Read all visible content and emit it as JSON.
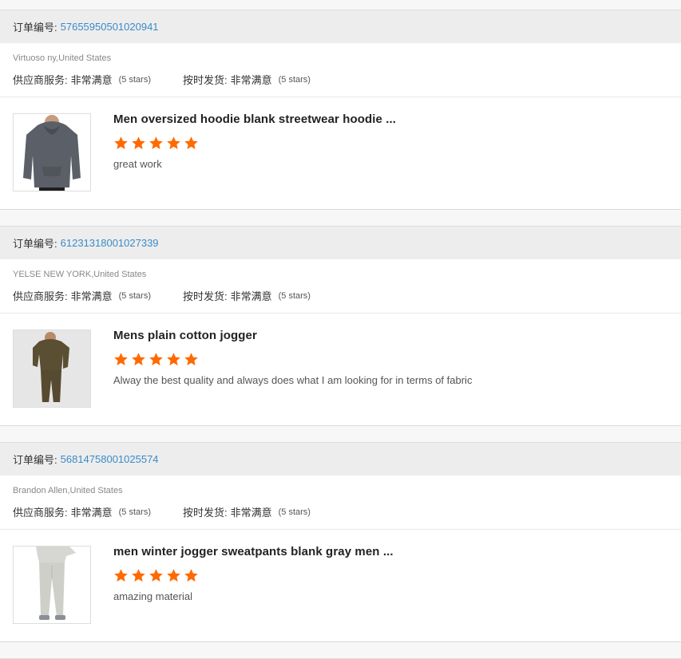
{
  "labels": {
    "order_no": "订单编号:",
    "supplier_service": "供应商服务:",
    "on_time": "按时发货:"
  },
  "orders": [
    {
      "order_no": "57655950501020941",
      "buyer": "Virtuoso ny,United States",
      "supplier_service_value": "非常满意",
      "supplier_service_stars": "(5 stars)",
      "on_time_value": "非常满意",
      "on_time_stars": "(5 stars)",
      "product_title": "Men oversized hoodie blank streetwear hoodie ...",
      "rating": 5,
      "comment": "great work"
    },
    {
      "order_no": "61231318001027339",
      "buyer": "YELSE NEW YORK,United States",
      "supplier_service_value": "非常满意",
      "supplier_service_stars": "(5 stars)",
      "on_time_value": "非常满意",
      "on_time_stars": "(5 stars)",
      "product_title": "Mens plain cotton jogger",
      "rating": 5,
      "comment": "Alway the best quality and always does what I am looking for in terms of fabric"
    },
    {
      "order_no": "56814758001025574",
      "buyer": "Brandon Allen,United States",
      "supplier_service_value": "非常满意",
      "supplier_service_stars": "(5 stars)",
      "on_time_value": "非常满意",
      "on_time_stars": "(5 stars)",
      "product_title": "men winter jogger sweatpants blank gray men ...",
      "rating": 5,
      "comment": "amazing material"
    }
  ],
  "colors": {
    "star": "#ff6a00",
    "link": "#3a8bc8"
  },
  "icons": [
    "star-icon",
    "hoodie-product-image",
    "jogger-set-product-image",
    "gray-sweatpants-product-image"
  ]
}
